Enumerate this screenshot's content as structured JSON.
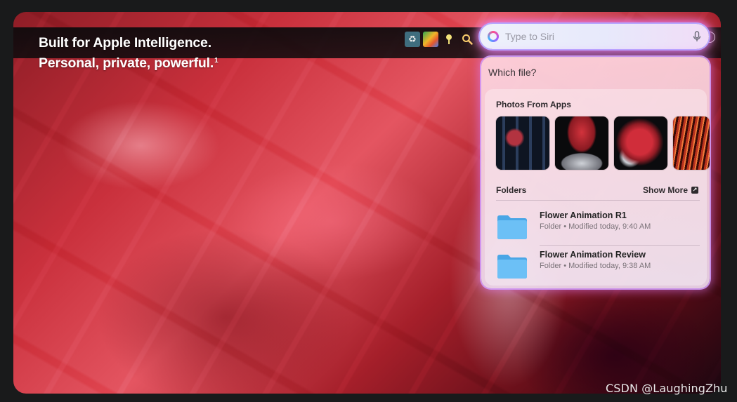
{
  "headline": {
    "line1": "Built for Apple Intelligence.",
    "line2": "Personal, private, powerful.",
    "footnote": "1"
  },
  "menubar": {
    "icons": [
      "recycle-icon",
      "color-chart-icon",
      "pin-icon",
      "search-zoom-icon"
    ]
  },
  "siri": {
    "placeholder": "Type to Siri",
    "icon": "siri-icon",
    "mic_icon": "microphone-icon"
  },
  "panel": {
    "question": "Which file?",
    "photos_section": "Photos From Apps",
    "folders_section": "Folders",
    "show_more": "Show More",
    "folders": [
      {
        "name": "Flower Animation R1",
        "meta": "Folder • Modified today, 9:40 AM"
      },
      {
        "name": "Flower Animation Review",
        "meta": "Folder • Modified today, 9:38 AM"
      }
    ]
  },
  "watermark": "CSDN @LaughingZhu",
  "colors": {
    "folder_blue": "#5fb7f1",
    "siri_glow": "#d98bff",
    "background": "#191a1b"
  }
}
